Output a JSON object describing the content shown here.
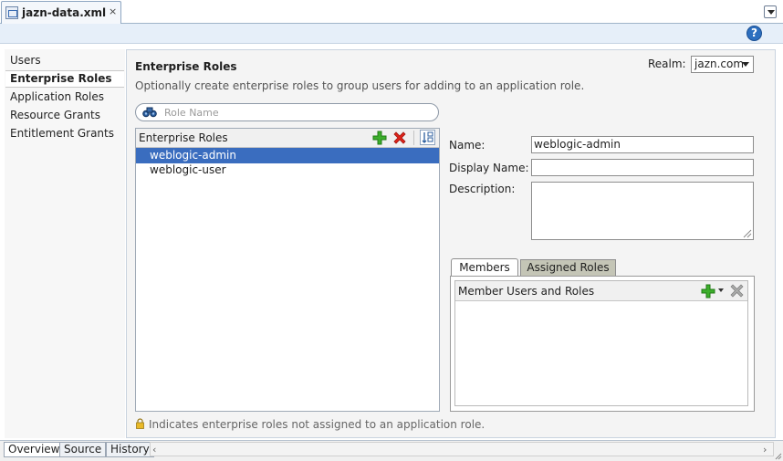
{
  "file_tab": {
    "title": "jazn-data.xml",
    "close": "×"
  },
  "help": {
    "label": "?"
  },
  "nav": {
    "items": [
      {
        "label": "Users",
        "selected": false
      },
      {
        "label": "Enterprise Roles",
        "selected": true
      },
      {
        "label": "Application Roles",
        "selected": false
      },
      {
        "label": "Resource Grants",
        "selected": false
      },
      {
        "label": "Entitlement Grants",
        "selected": false
      }
    ]
  },
  "page": {
    "title": "Enterprise Roles",
    "subtitle": "Optionally create enterprise roles to group users for adding to an application role."
  },
  "realm": {
    "label": "Realm:",
    "value": "jazn.com"
  },
  "search": {
    "placeholder": "Role Name",
    "value": ""
  },
  "roles": {
    "header": "Enterprise Roles",
    "items": [
      {
        "label": "weblogic-admin",
        "selected": true
      },
      {
        "label": "weblogic-user",
        "selected": false
      }
    ]
  },
  "details": {
    "name_label": "Name:",
    "name_value": "weblogic-admin",
    "display_name_label": "Display Name:",
    "display_name_value": "",
    "description_label": "Description:",
    "description_value": ""
  },
  "members_tabs": {
    "members": "Members",
    "assigned_roles": "Assigned Roles",
    "active": "Members"
  },
  "members": {
    "header": "Member Users and Roles",
    "items": []
  },
  "footnote": "Indicates enterprise roles not assigned to an application role.",
  "bottom_tabs": [
    {
      "label": "Overview",
      "selected": true
    },
    {
      "label": "Source",
      "selected": false
    },
    {
      "label": "History",
      "selected": false
    }
  ],
  "scroll": {
    "left_arrow": "‹",
    "right_arrow": "›"
  },
  "colors": {
    "selection": "#3a6dbf",
    "help_badge": "#2d6fbf",
    "assigned_tab_bg": "#c4c5b6",
    "add_icon": "#3cae2b",
    "delete_icon": "#e0241b"
  }
}
